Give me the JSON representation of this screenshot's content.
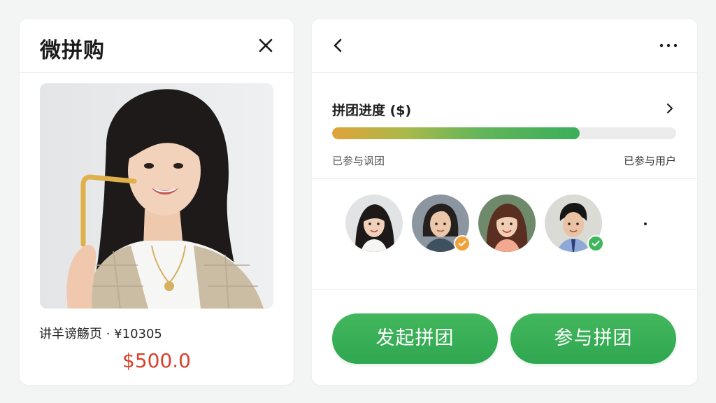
{
  "left_panel": {
    "title": "微拼购",
    "close_icon": "close-icon",
    "product": {
      "image": "woman-with-straw-product-photo",
      "name": "讲羊谤觞页 · ¥10305",
      "price": "$500.0"
    }
  },
  "right_panel": {
    "back_icon": "chevron-left-icon",
    "more_icon": "more-horizontal-icon",
    "progress": {
      "title": "拼团进度 ($)",
      "fraction": 0.72,
      "left_label": "已参与讽团",
      "right_label": "已参与用户"
    },
    "participants": [
      {
        "avatar": "avatar-1",
        "badge": null
      },
      {
        "avatar": "avatar-2",
        "badge": "orange-check"
      },
      {
        "avatar": "avatar-3",
        "badge": null
      },
      {
        "avatar": "avatar-4",
        "badge": "green-check"
      }
    ],
    "buttons": {
      "start_group": "发起拼团",
      "join_group": "参与拼团"
    }
  },
  "colors": {
    "accent_green": "#3aae5a",
    "price_red": "#d9412b",
    "badge_orange": "#f0a23a",
    "badge_green": "#3fb75c",
    "progress_start": "#e0a33a"
  }
}
